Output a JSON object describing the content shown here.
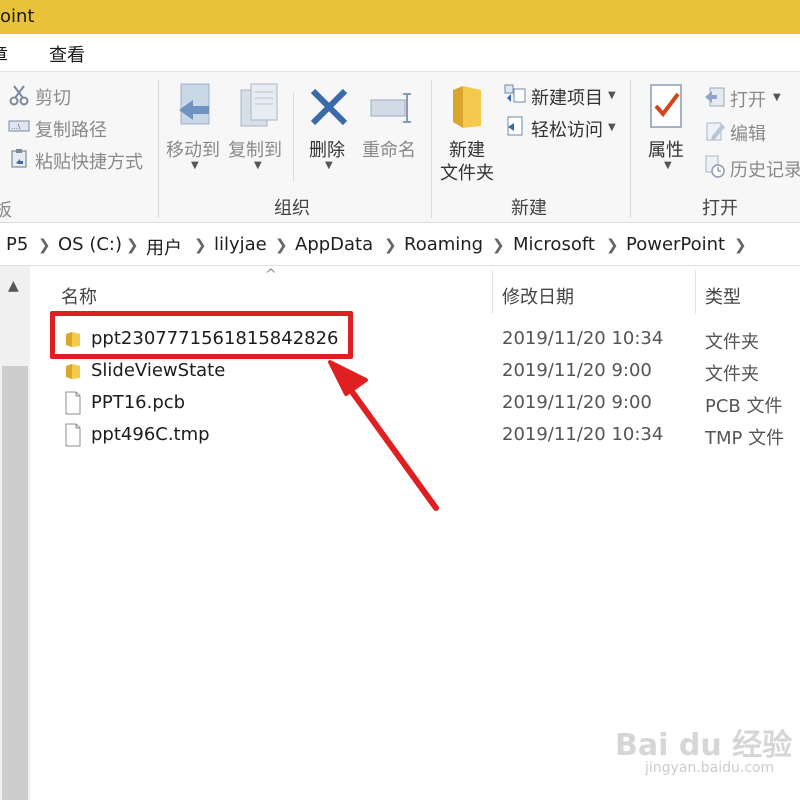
{
  "window": {
    "title_fragment": "oint"
  },
  "menu": {
    "item_left": "章",
    "item_view": "查看"
  },
  "ribbon": {
    "clipboard": {
      "cut": "剪切",
      "copy_path": "复制路径",
      "paste_shortcut": "粘贴快捷方式"
    },
    "organize": {
      "label": "组织",
      "move_to": "移动到",
      "copy_to": "复制到",
      "delete": "删除",
      "rename": "重命名"
    },
    "new": {
      "label": "新建",
      "new_folder_line1": "新建",
      "new_folder_line2": "文件夹",
      "new_item": "新建项目",
      "easy_access": "轻松访问"
    },
    "open": {
      "label": "打开",
      "properties": "属性",
      "open": "打开",
      "edit": "编辑",
      "history": "历史记录"
    }
  },
  "breadcrumb": [
    "P5",
    "OS (C:)",
    "用户",
    "lilyjae",
    "AppData",
    "Roaming",
    "Microsoft",
    "PowerPoint"
  ],
  "columns": {
    "name": "名称",
    "modified": "修改日期",
    "type": "类型"
  },
  "files": [
    {
      "name": "ppt2307771561815842826",
      "modified": "2019/11/20 10:34",
      "type": "文件夹",
      "kind": "folder"
    },
    {
      "name": "SlideViewState",
      "modified": "2019/11/20 9:00",
      "type": "文件夹",
      "kind": "folder"
    },
    {
      "name": "PPT16.pcb",
      "modified": "2019/11/20 9:00",
      "type": "PCB 文件",
      "kind": "file"
    },
    {
      "name": "ppt496C.tmp",
      "modified": "2019/11/20 10:34",
      "type": "TMP 文件",
      "kind": "file"
    }
  ],
  "watermark": {
    "main": "Bai du 经验",
    "sub": "jingyan.baidu.com"
  },
  "colors": {
    "titlebar": "#e8c33a",
    "folder": "#e8b33a",
    "annotation": "#e02020",
    "delete_icon": "#3a6aa8"
  }
}
